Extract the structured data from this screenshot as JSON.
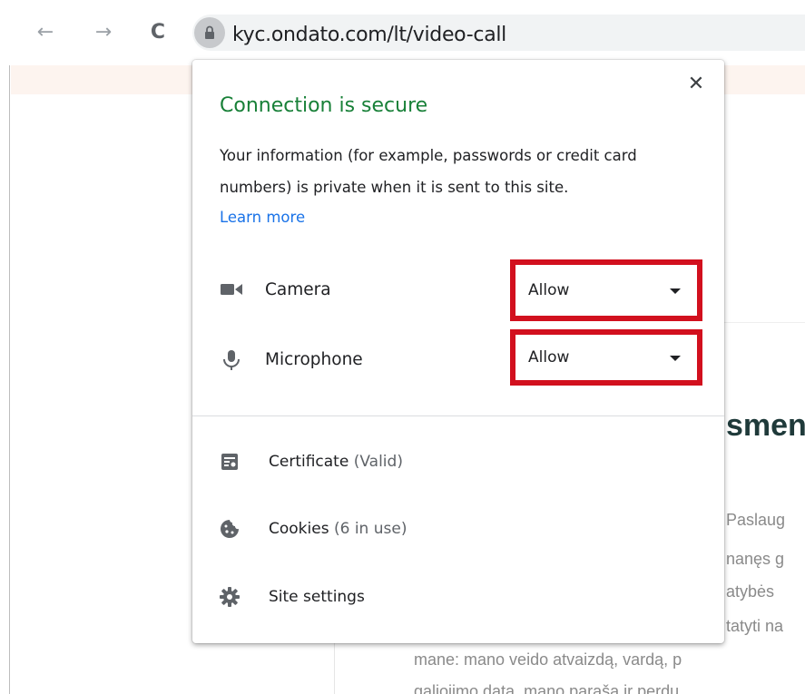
{
  "browser": {
    "url": "kyc.ondato.com/lt/video-call",
    "back_glyph": "←",
    "forward_glyph": "→",
    "reload_glyph": "C"
  },
  "popup": {
    "title": "Connection is secure",
    "description": "Your information (for example, passwords or credit card numbers) is private when it is sent to this site.",
    "learn_more": "Learn more",
    "close_glyph": "✕",
    "permissions": [
      {
        "label": "Camera",
        "value": "Allow",
        "icon": "camera-icon"
      },
      {
        "label": "Microphone",
        "value": "Allow",
        "icon": "microphone-icon"
      }
    ],
    "certificate": {
      "label": "Certificate",
      "status": "(Valid)"
    },
    "cookies": {
      "label": "Cookies",
      "status": "(6 in use)"
    },
    "site_settings": {
      "label": "Site settings"
    }
  },
  "page_background": {
    "heading_fragment": "smen",
    "lines": [
      "Paslaug",
      "nanęs g",
      "atybės",
      "tatyti na",
      "mane: mano veido atvaizdą, vardą, p",
      "galiojimo data, mano parašą ir perdu"
    ]
  },
  "colors": {
    "secure_green": "#188038",
    "link_blue": "#1a73e8",
    "highlight_red": "#d2101e"
  }
}
